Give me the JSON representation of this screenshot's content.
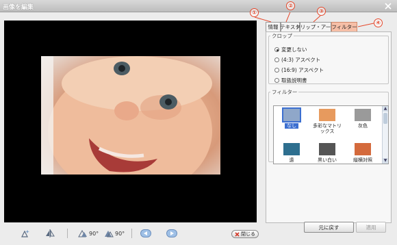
{
  "window": {
    "title": "画像を編集",
    "close_icon": "close-icon"
  },
  "toolbar": {
    "rotate_left_label": "90°",
    "rotate_right_label": "90°",
    "close_label": "閉じる"
  },
  "tabs": [
    {
      "label": "情報",
      "callout": "①"
    },
    {
      "label": "テキスト",
      "callout": "②"
    },
    {
      "label": "クリップ・アート",
      "callout": "③"
    },
    {
      "label": "フィルター",
      "callout": "④",
      "active": true
    }
  ],
  "crop": {
    "legend": "クロップ",
    "options": [
      {
        "label": "変更しない",
        "selected": true
      },
      {
        "label": "(4:3) アスペクト",
        "selected": false
      },
      {
        "label": "(16:9) アスペクト",
        "selected": false
      },
      {
        "label": "取扱説明書",
        "selected": false
      }
    ]
  },
  "filter": {
    "legend": "フィルター",
    "items": [
      {
        "label": "なし",
        "selected": true,
        "color": "#8fa7c9"
      },
      {
        "label": "多彩なマトリックス",
        "selected": false,
        "color": "#e79a5e"
      },
      {
        "label": "灰色",
        "selected": false,
        "color": "#9a9a9a"
      },
      {
        "label": "遠",
        "selected": false,
        "color": "#2e6f8f"
      },
      {
        "label": "黒い白い",
        "selected": false,
        "color": "#555555"
      },
      {
        "label": "縦横対照",
        "selected": false,
        "color": "#d46a3c"
      }
    ]
  },
  "actions": {
    "reset_label": "元に戻す",
    "apply_label": "適用"
  },
  "colors": {
    "active_tab": "#f6bfa7",
    "callout": "#e5472a",
    "selection": "#3c6fd0"
  }
}
